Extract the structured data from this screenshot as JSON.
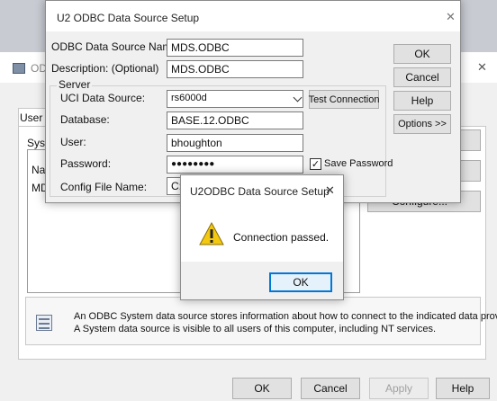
{
  "bg_window": {
    "title_partial": "OD",
    "tab_partial": "User D",
    "group_partial": "Syst",
    "list_header_partial": "Na",
    "list_row_partial": "MD",
    "configure_partial": "Configure...",
    "info_text_line1": "An ODBC System data source stores information about how to connect to the indicated data provider.",
    "info_text_line2": "A System data source is visible to all users of this computer, including NT services.",
    "ok_label": "OK",
    "cancel_label": "Cancel",
    "apply_label": "Apply",
    "help_label": "Help",
    "close_glyph": "✕"
  },
  "setup_dialog": {
    "title": "U2 ODBC Data Source Setup",
    "close_glyph": "✕",
    "dsn_label": "ODBC Data Source Name:",
    "dsn_value": "MDS.ODBC",
    "desc_label": "Description: (Optional)",
    "desc_value": "MDS.ODBC",
    "server_group": "Server",
    "uci_label": "UCI Data Source:",
    "uci_value": "rs6000d",
    "test_connection_label": "Test Connection",
    "database_label": "Database:",
    "database_value": "BASE.12.ODBC",
    "user_label": "User:",
    "user_value": "bhoughton",
    "password_label": "Password:",
    "password_value": "●●●●●●●●",
    "save_password_label": "Save Password",
    "save_password_checked": "✓",
    "config_label": "Config File Name:",
    "config_value": "C:\\",
    "ok_label": "OK",
    "cancel_label": "Cancel",
    "help_label": "Help",
    "options_label": "Options >>"
  },
  "message_box": {
    "title": "U2ODBC Data Source Setup",
    "close_glyph": "✕",
    "message": "Connection passed.",
    "ok_label": "OK",
    "icon": "warning-icon"
  },
  "colors": {
    "accent": "#0078d7",
    "warning": "#f2c811"
  }
}
